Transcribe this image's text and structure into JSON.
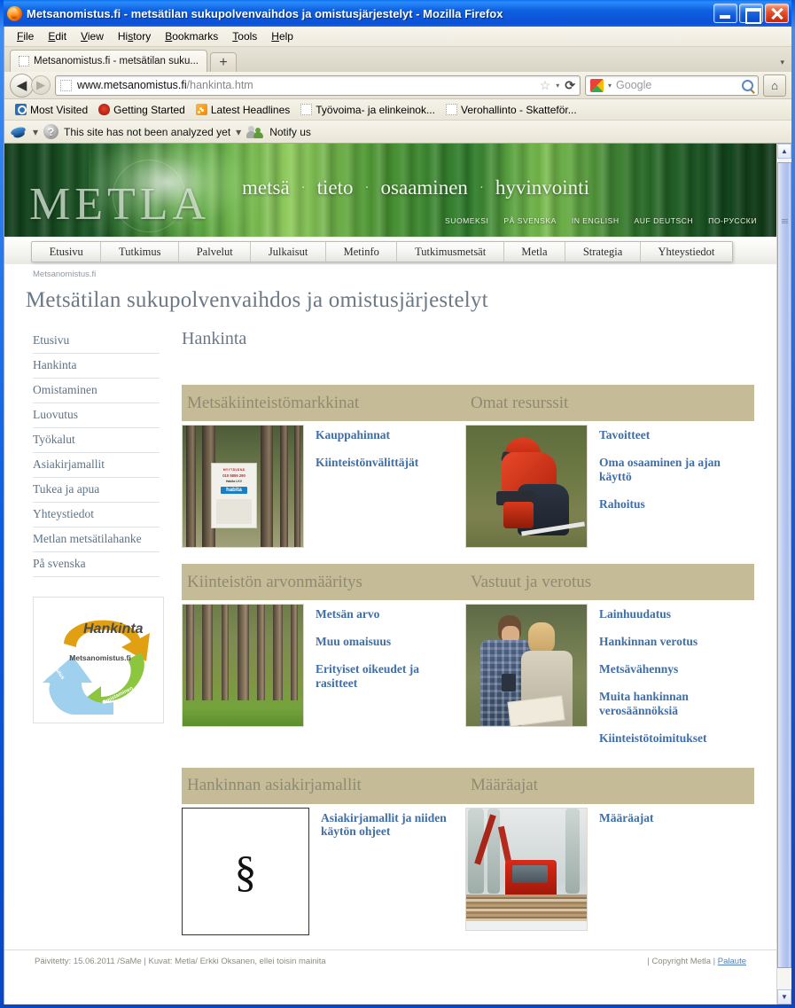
{
  "window": {
    "title": "Metsanomistus.fi - metsätilan sukupolvenvaihdos ja omistusjärjestelyt - Mozilla Firefox",
    "minimize_label": "Minimize",
    "maximize_label": "Maximize",
    "close_label": "Close"
  },
  "menubar": {
    "items": [
      "File",
      "Edit",
      "View",
      "History",
      "Bookmarks",
      "Tools",
      "Help"
    ]
  },
  "tabbar": {
    "tab_title": "Metsanomistus.fi - metsätilan suku...",
    "new_tab_label": "+",
    "tab_list_label": "▾"
  },
  "navbar": {
    "back_label": "◀",
    "forward_label": "▶",
    "url_bold": "www.metsanomistus.fi",
    "url_dim": "/hankinta.htm",
    "star_label": "☆",
    "caret_label": "▾",
    "reload_label": "⟳",
    "search_placeholder": "Google",
    "home_label": "⌂"
  },
  "bookmarks": {
    "items": [
      {
        "label": "Most Visited",
        "icon": "mostvisited-icon"
      },
      {
        "label": "Getting Started",
        "icon": "firefox-icon"
      },
      {
        "label": "Latest Headlines",
        "icon": "rss-icon"
      },
      {
        "label": "Työvoima- ja elinkeinok...",
        "icon": "bookmark-icon"
      },
      {
        "label": "Verohallinto - Skatteför...",
        "icon": "bookmark-icon"
      }
    ]
  },
  "wot_bar": {
    "separator": "▾",
    "status_text": "This site has not been analyzed yet",
    "dot": "▾",
    "notify_label": "Notify us"
  },
  "banner": {
    "logo_text": "METLA",
    "slogan": [
      "metsä",
      "tieto",
      "osaaminen",
      "hyvinvointi"
    ],
    "separator": "·",
    "languages": [
      "SUOMEKSI",
      "PÅ SVENSKA",
      "IN ENGLISH",
      "AUF DEUTSCH",
      "ПО-РУССКИ"
    ]
  },
  "sitenav": {
    "tabs": [
      "Etusivu",
      "Tutkimus",
      "Palvelut",
      "Julkaisut",
      "Metinfo",
      "Tutkimusmetsät",
      "Metla",
      "Strategia",
      "Yhteystiedot"
    ]
  },
  "page": {
    "breadcrumb": "Metsanomistus.fi",
    "title": "Metsätilan sukupolvenvaihdos ja omistusjärjestelyt",
    "content_heading": "Hankinta"
  },
  "sidebar": {
    "items": [
      "Etusivu",
      "Hankinta",
      "Omistaminen",
      "Luovutus",
      "Työkalut",
      "Asiakirjamallit",
      "Tukea ja apua",
      "Yhteystiedot",
      "Metlan metsätilahanke",
      "På svenska"
    ],
    "logo": {
      "title": "Hankinta",
      "center": "Metsanomistus.fi",
      "arrow_green_label": "Omistaminen",
      "arrow_blue_label": "Luovutus"
    }
  },
  "sections": [
    {
      "left_title": "Metsäkiinteistömarkkinat",
      "right_title": "Omat resurssit",
      "left_image": "forest-for-sale-sign-photo",
      "right_image": "forest-worker-photo",
      "left_links": [
        "Kauppahinnat",
        "Kiinteistönvälittäjät"
      ],
      "right_links": [
        "Tavoitteet",
        "Oma osaaminen ja ajan käyttö",
        "Rahoitus"
      ]
    },
    {
      "left_title": "Kiinteistön arvonmääritys",
      "right_title": "Vastuut ja verotus",
      "left_image": "pine-forest-photo",
      "right_image": "couple-with-map-photo",
      "left_links": [
        "Metsän arvo",
        "Muu omaisuus",
        "Erityiset oikeudet ja rasitteet"
      ],
      "right_links": [
        "Lainhuudatus",
        "Hankinnan verotus",
        "Metsävähennys",
        "Muita hankinnan verosäännöksiä",
        "Kiinteistötoimitukset"
      ]
    },
    {
      "left_title": "Hankinnan asiakirjamallit",
      "right_title": "Määräajat",
      "left_image": "paragraph-sign-document",
      "right_image": "winter-forestry-truck-photo",
      "left_glyph": "§",
      "left_links": [
        "Asiakirjamallit ja niiden käytön ohjeet"
      ],
      "right_links": [
        "Määräajat"
      ]
    }
  ],
  "footer": {
    "left": "Päivitetty: 15.06.2011 /SaMe | Kuvat: Metla/ Erkki Oksanen, ellei toisin mainita",
    "copyright": "| Copyright Metla |",
    "feedback": "Palaute"
  },
  "scrollbar": {
    "up": "▲",
    "down": "▼"
  },
  "sign_photo": {
    "line1": "MYYTÄVÄNÄ",
    "line2": "010 5855 290",
    "line3": "Habita LKV",
    "brand": "habita"
  },
  "colors": {
    "band": "#c5bb96",
    "link": "#3f6fa6",
    "title": "#6b7886",
    "sidebar_link": "#5e7486"
  }
}
